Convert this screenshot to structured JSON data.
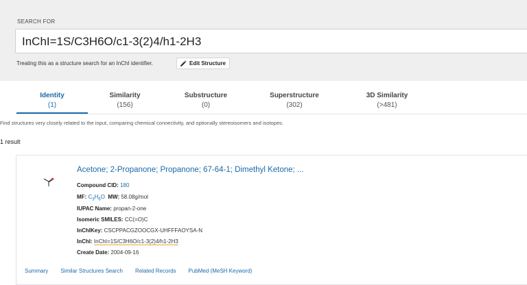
{
  "search": {
    "label": "SEARCH FOR",
    "value": "InChI=1S/C3H6O/c1-3(2)4/h1-2H3",
    "treating_text": "Treating this as a structure search for an InChI identifier.",
    "edit_button": "Edit Structure"
  },
  "tabs": [
    {
      "label": "Identity",
      "count": "(1)",
      "active": true
    },
    {
      "label": "Similarity",
      "count": "(156)",
      "active": false
    },
    {
      "label": "Substructure",
      "count": "(0)",
      "active": false
    },
    {
      "label": "Superstructure",
      "count": "(302)",
      "active": false
    },
    {
      "label": "3D Similarity",
      "count": "(>481)",
      "active": false
    }
  ],
  "description": "Find structures very closely related to the input, comparing chemical connectivity, and optionally stereoisomers and isotopes.",
  "result_count": "1 result",
  "result": {
    "title": "Acetone; 2-Propanone; Propanone; 67-64-1; Dimethyl Ketone; ...",
    "cid_label": "Compound CID:",
    "cid_value": "180",
    "mf_label": "MF:",
    "mf_c": "C",
    "mf_c_sub": "3",
    "mf_h": "H",
    "mf_h_sub": "6",
    "mf_o": "O",
    "mw_label": "MW:",
    "mw_value": "58.08g/mol",
    "iupac_label": "IUPAC Name:",
    "iupac_value": "propan-2-one",
    "smiles_label": "Isomeric SMILES:",
    "smiles_value": "CC(=O)C",
    "inchikey_label": "InChIKey:",
    "inchikey_value": "CSCPPACGZOOCGX-UHFFFAOYSA-N",
    "inchi_label": "InChI:",
    "inchi_value": "InChI=1S/C3H6O/c1-3(2)4/h1-2H3",
    "date_label": "Create Date:",
    "date_value": "2004-09-16"
  },
  "links": [
    "Summary",
    "Similar Structures Search",
    "Related Records",
    "PubMed (MeSH Keyword)"
  ],
  "colors": {
    "accent": "#1b6aa9",
    "highlight": "#e8a33b",
    "band": "#efeff0"
  },
  "icons": {
    "edit": "pencil-icon",
    "structure": "molecule-structure-icon"
  }
}
